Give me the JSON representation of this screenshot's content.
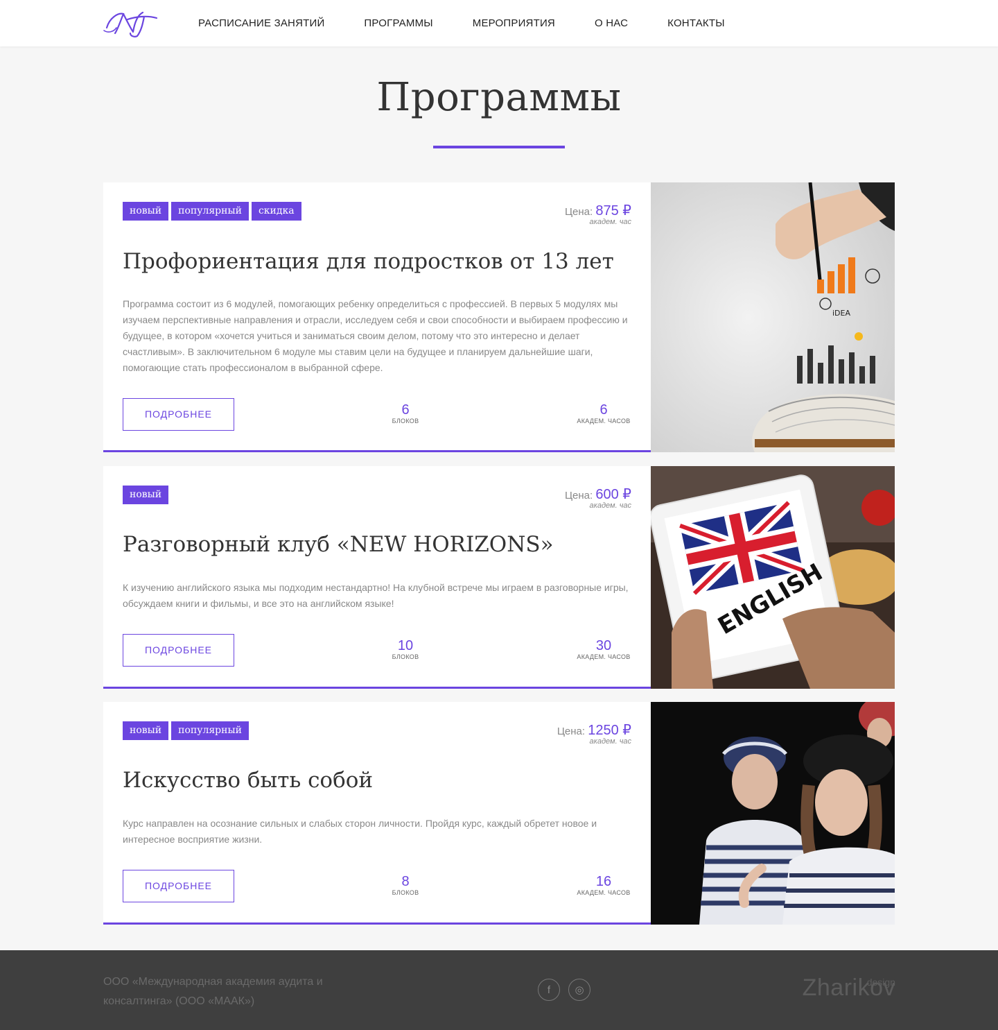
{
  "header": {
    "nav": [
      {
        "label": "Расписание занятий"
      },
      {
        "label": "Программы"
      },
      {
        "label": "Мероприятия"
      },
      {
        "label": "О нас"
      },
      {
        "label": "Контакты"
      }
    ]
  },
  "page": {
    "title": "Программы"
  },
  "programs": [
    {
      "tags": [
        "новый",
        "популярный",
        "скидка"
      ],
      "price_label": "Цена:",
      "price": "875 ₽",
      "price_unit": "академ. час",
      "title": "Профориентация для подростков от 13 лет",
      "description": "Программа состоит из 6 модулей, помогающих ребенку определиться с профессией. В первых 5 модулях мы изучаем перспективные направления и отрасли, исследуем себя и свои способности и выбираем профессию и будущее, в котором «хочется учиться и заниматься своим делом, потому что это интересно и делает счастливым». В заключительном 6 модуле мы ставим цели на будущее и планируем дальнейшие шаги, помогающие стать профессионалом в выбранной сфере.",
      "button": "Подробнее",
      "blocks_value": "6",
      "blocks_label": "блоков",
      "hours_value": "6",
      "hours_label": "академ. часов",
      "image": "hand-drawing-charts-over-book"
    },
    {
      "tags": [
        "новый"
      ],
      "price_label": "Цена:",
      "price": "600 ₽",
      "price_unit": "академ. час",
      "title": "Разговорный клуб «NEW HORIZONS»",
      "description": "К изучению английского языка мы подходим нестандартно! На клубной встрече мы играем в разговорные игры, обсуждаем книги и фильмы, и все это на английском языке!",
      "button": "Подробнее",
      "blocks_value": "10",
      "blocks_label": "блоков",
      "hours_value": "30",
      "hours_label": "академ. часов",
      "image": "tablet-with-uk-flag-english",
      "image_text": "ENGLISH"
    },
    {
      "tags": [
        "новый",
        "популярный"
      ],
      "price_label": "Цена:",
      "price": "1250 ₽",
      "price_unit": "академ. час",
      "title": "Искусство быть собой",
      "description": "Курс направлен на осознание сильных и слабых сторон личности. Пройдя курс, каждый обретет новое и интересное восприятие жизни.",
      "button": "Подробнее",
      "blocks_value": "8",
      "blocks_label": "блоков",
      "hours_value": "16",
      "hours_label": "академ. часов",
      "image": "girls-in-striped-shirts-and-berets"
    }
  ],
  "footer": {
    "company": "ООО «Международная академия аудита и консалтинга» (ООО «МААК»)",
    "social": [
      {
        "icon": "facebook-icon",
        "glyph": "f"
      },
      {
        "icon": "instagram-icon",
        "glyph": "◎"
      }
    ],
    "brand_main": "Zharikov",
    "brand_sup": "design"
  },
  "colors": {
    "accent": "#6b45e0",
    "background": "#f6f6f6",
    "footer": "#3f3f3f"
  }
}
